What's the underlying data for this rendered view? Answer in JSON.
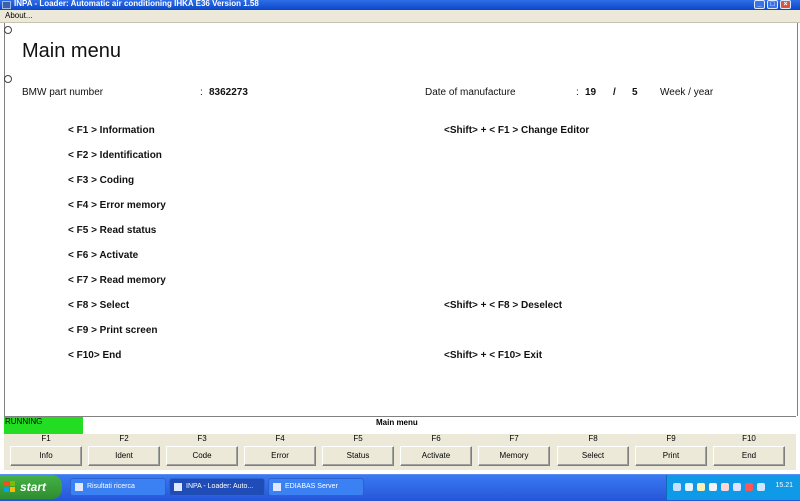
{
  "window": {
    "title": "INPA - Loader:  Automatic air conditioning IHKA E36 Version 1.58",
    "menu": [
      "About..."
    ]
  },
  "main": {
    "heading": "Main menu",
    "part_label": "BMW part number",
    "part_colon": ":",
    "part_value": "8362273",
    "date_label": "Date of manufacture",
    "date_colon": ":",
    "date_week": "19",
    "date_sep": "/",
    "date_year": "5",
    "date_unit": "Week / year",
    "left_keys": [
      "< F1 >  Information",
      "< F2 >  Identification",
      "< F3 >  Coding",
      "< F4 >  Error memory",
      "< F5 >  Read status",
      "< F6 >  Activate",
      "< F7 >  Read memory",
      "< F8 >  Select",
      "< F9 >  Print screen",
      "< F10>  End"
    ],
    "right_keys": {
      "f1": "<Shift> + < F1 >  Change Editor",
      "f8": "<Shift> + < F8 >  Deselect",
      "f10": "<Shift> + < F10>  Exit"
    }
  },
  "status": {
    "state": "RUNNING",
    "state_color": "#22dd22",
    "title": "Main menu"
  },
  "function_keys": [
    {
      "key": "F1",
      "label": "Info"
    },
    {
      "key": "F2",
      "label": "Ident"
    },
    {
      "key": "F3",
      "label": "Code"
    },
    {
      "key": "F4",
      "label": "Error"
    },
    {
      "key": "F5",
      "label": "Status"
    },
    {
      "key": "F6",
      "label": "Activate"
    },
    {
      "key": "F7",
      "label": "Memory"
    },
    {
      "key": "F8",
      "label": "Select"
    },
    {
      "key": "F9",
      "label": "Print"
    },
    {
      "key": "F10",
      "label": "End"
    }
  ],
  "taskbar": {
    "start": "start",
    "tasks": [
      "Risultati ricerca",
      "INPA - Loader:  Auto...",
      "EDIABAS Server"
    ],
    "clock": "15.21"
  }
}
